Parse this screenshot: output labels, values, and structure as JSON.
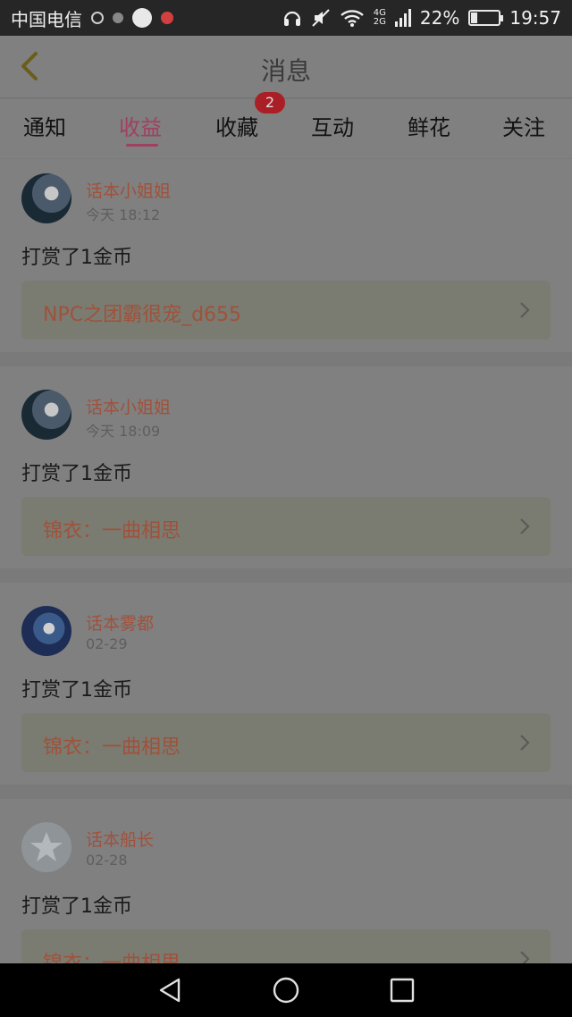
{
  "status_bar": {
    "carrier": "中国电信",
    "network": [
      "4G",
      "2G"
    ],
    "battery_text": "22%",
    "battery_level": 0.22,
    "time": "19:57"
  },
  "header": {
    "title": "消息",
    "back_icon": "chevron-left-icon"
  },
  "tabs": {
    "items": [
      "通知",
      "收益",
      "收藏",
      "互动",
      "鲜花",
      "关注"
    ],
    "active": "收益",
    "badge_on": "收藏",
    "badge_count": "2"
  },
  "feed": [
    {
      "nickname": "话本小姐姐",
      "time": "今天 18:12",
      "action": "打赏了1金币",
      "book": "NPC之团霸很宠_d655"
    },
    {
      "nickname": "话本小姐姐",
      "time": "今天 18:09",
      "action": "打赏了1金币",
      "book": "锦衣：一曲相思"
    },
    {
      "nickname": "话本雾都",
      "time": "02-29",
      "action": "打赏了1金币",
      "book": "锦衣：一曲相思"
    },
    {
      "nickname": "话本船长",
      "time": "02-28",
      "action": "打赏了1金币",
      "book": "锦衣：一曲相思"
    }
  ],
  "colors": {
    "accent": "#a04060",
    "link": "#a0513a",
    "badge": "#aa1f25"
  },
  "navbar": [
    "back-triangle-icon",
    "home-circle-icon",
    "recents-square-icon"
  ]
}
